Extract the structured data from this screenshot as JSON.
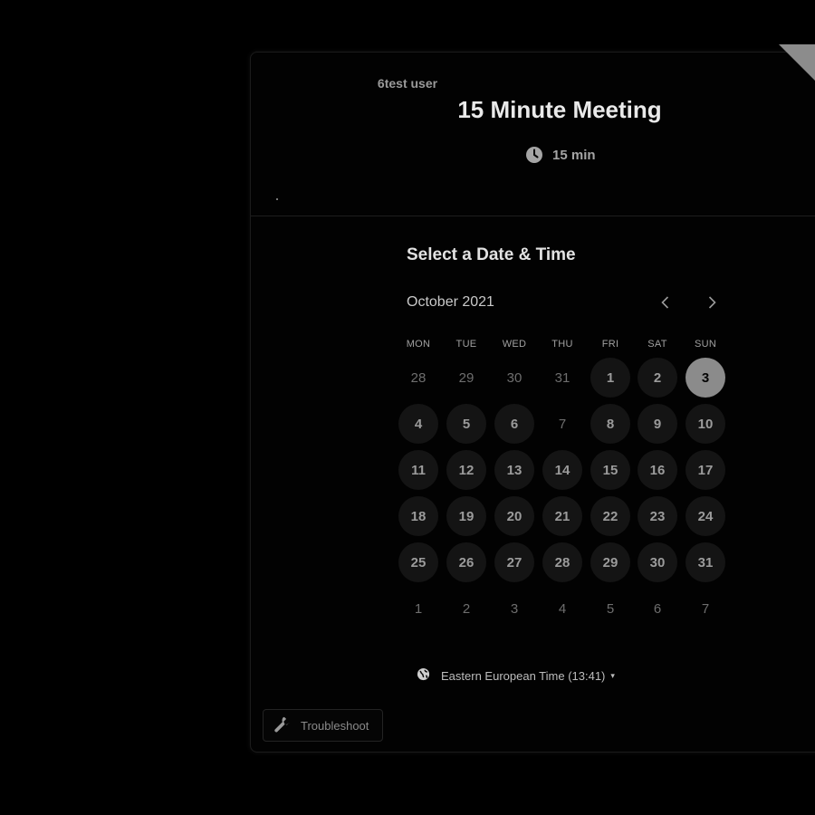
{
  "header": {
    "owner": "6test user",
    "title": "15 Minute Meeting",
    "duration": "15 min",
    "duration_icon": "clock-icon"
  },
  "calendar": {
    "section_title": "Select a Date & Time",
    "month_label": "October 2021",
    "prev_icon": "chevron-left-icon",
    "next_icon": "chevron-right-icon",
    "weekdays": [
      "MON",
      "TUE",
      "WED",
      "THU",
      "FRI",
      "SAT",
      "SUN"
    ],
    "weeks": [
      [
        {
          "d": "28",
          "s": "muted"
        },
        {
          "d": "29",
          "s": "muted"
        },
        {
          "d": "30",
          "s": "muted"
        },
        {
          "d": "31",
          "s": "muted"
        },
        {
          "d": "1",
          "s": "avail"
        },
        {
          "d": "2",
          "s": "avail"
        },
        {
          "d": "3",
          "s": "selected"
        }
      ],
      [
        {
          "d": "4",
          "s": "avail"
        },
        {
          "d": "5",
          "s": "avail"
        },
        {
          "d": "6",
          "s": "avail"
        },
        {
          "d": "7",
          "s": "unavailable"
        },
        {
          "d": "8",
          "s": "avail"
        },
        {
          "d": "9",
          "s": "avail"
        },
        {
          "d": "10",
          "s": "avail"
        }
      ],
      [
        {
          "d": "11",
          "s": "avail"
        },
        {
          "d": "12",
          "s": "avail"
        },
        {
          "d": "13",
          "s": "avail"
        },
        {
          "d": "14",
          "s": "avail"
        },
        {
          "d": "15",
          "s": "avail"
        },
        {
          "d": "16",
          "s": "avail"
        },
        {
          "d": "17",
          "s": "avail"
        }
      ],
      [
        {
          "d": "18",
          "s": "avail"
        },
        {
          "d": "19",
          "s": "avail"
        },
        {
          "d": "20",
          "s": "avail"
        },
        {
          "d": "21",
          "s": "avail"
        },
        {
          "d": "22",
          "s": "avail"
        },
        {
          "d": "23",
          "s": "avail"
        },
        {
          "d": "24",
          "s": "avail"
        }
      ],
      [
        {
          "d": "25",
          "s": "avail"
        },
        {
          "d": "26",
          "s": "avail"
        },
        {
          "d": "27",
          "s": "avail"
        },
        {
          "d": "28",
          "s": "avail"
        },
        {
          "d": "29",
          "s": "avail"
        },
        {
          "d": "30",
          "s": "avail"
        },
        {
          "d": "31",
          "s": "avail"
        }
      ],
      [
        {
          "d": "1",
          "s": "muted"
        },
        {
          "d": "2",
          "s": "muted"
        },
        {
          "d": "3",
          "s": "muted"
        },
        {
          "d": "4",
          "s": "muted"
        },
        {
          "d": "5",
          "s": "muted"
        },
        {
          "d": "6",
          "s": "muted"
        },
        {
          "d": "7",
          "s": "muted"
        }
      ]
    ]
  },
  "timezone": {
    "label": "Eastern European Time (13:41)",
    "icon": "globe-icon",
    "caret": "▾"
  },
  "troubleshoot": {
    "label": "Troubleshoot",
    "icon": "wrench-icon"
  },
  "colors": {
    "background": "#000000",
    "selected_day": "#8b8b8b",
    "available_day": "#141414"
  }
}
